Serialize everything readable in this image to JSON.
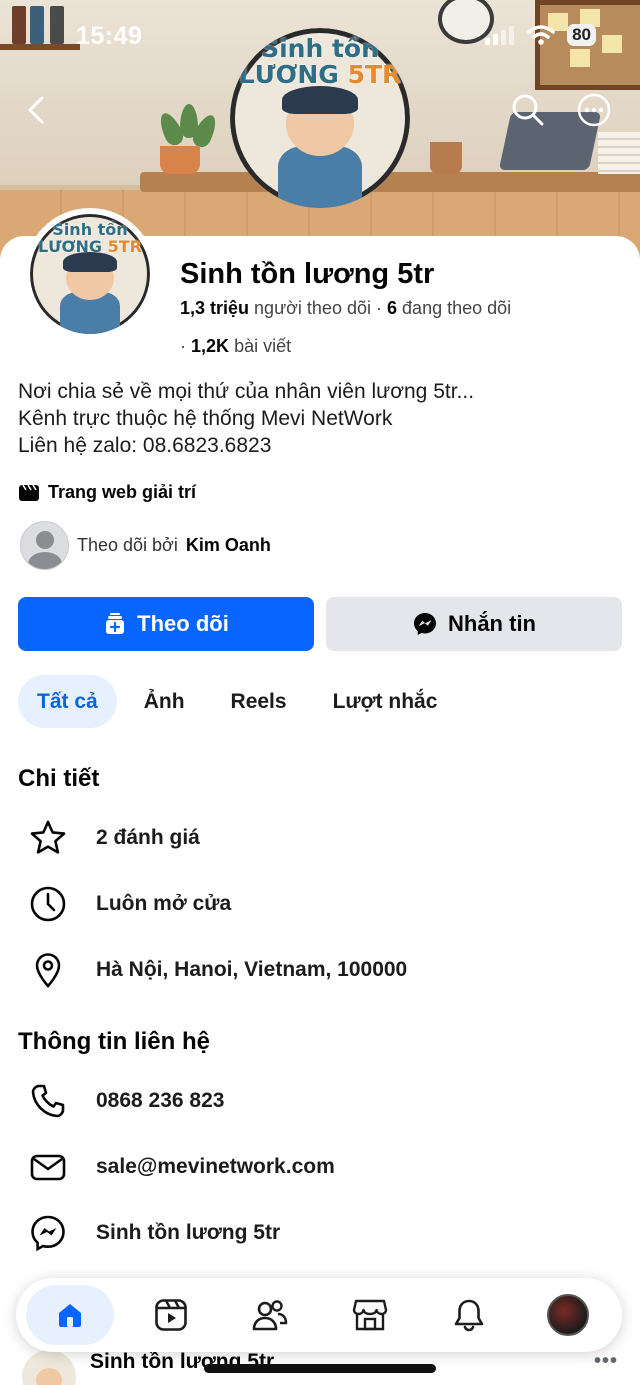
{
  "status_bar": {
    "time": "15:49",
    "battery": "80"
  },
  "cover": {
    "logo_line1": "Sinh tồn",
    "logo_line2": "LƯƠNG",
    "logo_accent": "5TR"
  },
  "profile": {
    "name": "Sinh tồn lương 5tr",
    "followers_count": "1,3 triệu",
    "followers_label": "người theo dõi",
    "following_count": "6",
    "following_label": "đang theo dõi",
    "posts_count": "1,2K",
    "posts_label": "bài viết",
    "bio_line1": "Nơi chia sẻ về mọi thứ của nhân viên lương 5tr...",
    "bio_line2": "Kênh trực thuộc hệ thống Mevi NetWork",
    "bio_line3": "Liên hệ zalo: 08.6823.6823",
    "category": "Trang web giải trí",
    "followed_by_prefix": "Theo dõi bởi",
    "followed_by_name": "Kim Oanh"
  },
  "actions": {
    "follow": "Theo dõi",
    "message": "Nhắn tin"
  },
  "tabs": [
    "Tất cả",
    "Ảnh",
    "Reels",
    "Lượt nhắc"
  ],
  "details": {
    "title": "Chi tiết",
    "rating": "2 đánh giá",
    "hours": "Luôn mở cửa",
    "address": "Hà Nội, Hanoi, Vietnam, 100000"
  },
  "contact": {
    "title": "Thông tin liên hệ",
    "phone": "0868 236 823",
    "email": "sale@mevinetwork.com",
    "messenger": "Sinh tồn lương 5tr"
  },
  "post_peek": {
    "name": "Sinh tồn lương 5tr"
  },
  "colors": {
    "primary": "#0866ff",
    "tab_active_bg": "#e7f0fd",
    "tab_active_text": "#0a66d8",
    "secondary_btn": "#e4e6eb"
  },
  "icons": [
    "back-icon",
    "search-icon",
    "more-icon",
    "star-icon",
    "clock-icon",
    "location-pin-icon",
    "phone-icon",
    "email-icon",
    "messenger-icon",
    "home-icon",
    "reels-icon",
    "friends-icon",
    "marketplace-icon",
    "bell-icon"
  ]
}
